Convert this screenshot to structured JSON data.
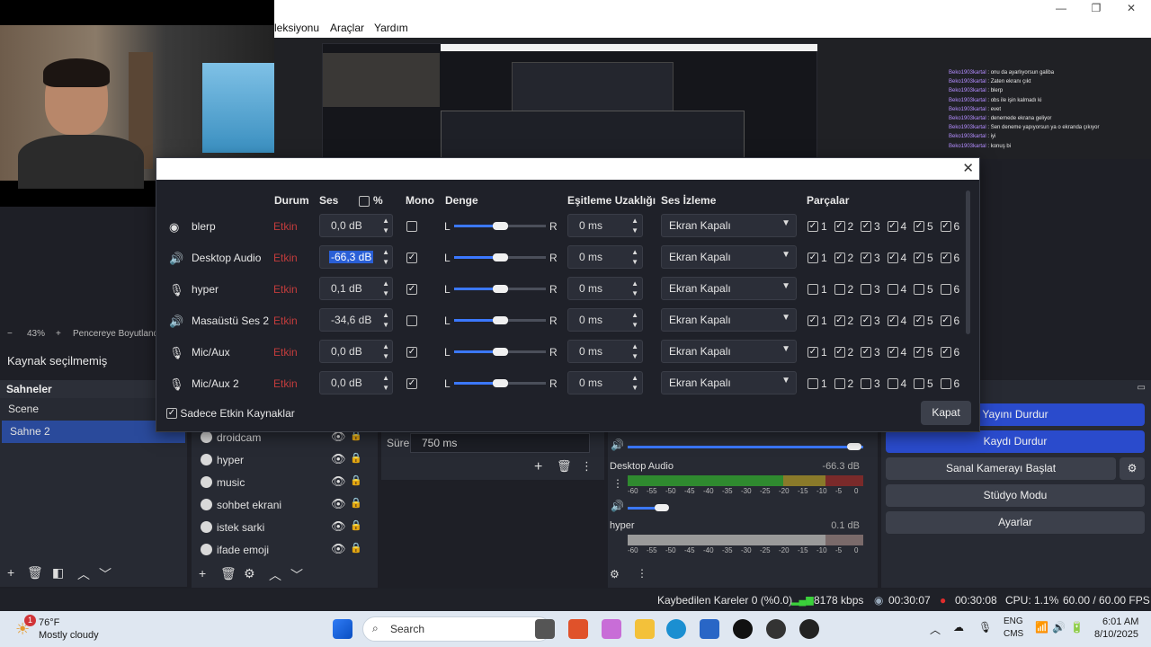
{
  "menu": {
    "items": [
      "leksiyonu",
      "Araçlar",
      "Yardım"
    ]
  },
  "chat": [
    {
      "user": "Beko1903kartal",
      "msg": "onu da ayarlıyorsun galiba"
    },
    {
      "user": "Beko1903kartal",
      "msg": "Zaten ekranı çıkt"
    },
    {
      "user": "Beko1903kartal",
      "msg": "blerp"
    },
    {
      "user": "Beko1903kartal",
      "msg": "obs ile işin kalmadı ki"
    },
    {
      "user": "Beko1903kartal",
      "msg": "evet"
    },
    {
      "user": "Beko1903kartal",
      "msg": "denemede ekrana geliyor"
    },
    {
      "user": "Beko1903kartal",
      "msg": "Sen deneme yapıyorsun ya o ekranda çıkıyor"
    },
    {
      "user": "Beko1903kartal",
      "msg": "iyi"
    },
    {
      "user": "Beko1903kartal",
      "msg": "konuş bi"
    }
  ],
  "zoom": {
    "minus": "−",
    "value": "43%",
    "plus": "+",
    "fit_label": "Pencereye Boyutland"
  },
  "source_status": "Kaynak seçilmemiş",
  "scenes": {
    "title": "Sahneler",
    "items": [
      {
        "label": "Scene",
        "active": false
      },
      {
        "label": "Sahne 2",
        "active": true
      }
    ]
  },
  "sources": {
    "items": [
      "droidcam",
      "hyper",
      "music",
      "sohbet ekrani",
      "istek sarki",
      "ifade emoji"
    ]
  },
  "transitions": {
    "label": "Süre",
    "duration": "750 ms"
  },
  "mixer": {
    "channels": [
      {
        "name": "Desktop Audio",
        "value": "-66.3 dB"
      },
      {
        "name": "hyper",
        "value": "0.1 dB"
      }
    ],
    "scale": [
      "-60",
      "-55",
      "-50",
      "-45",
      "-40",
      "-35",
      "-30",
      "-25",
      "-20",
      "-15",
      "-10",
      "-5",
      "0"
    ]
  },
  "controls": {
    "buttons": [
      {
        "label": "Yayını Durdur",
        "active": true
      },
      {
        "label": "Kaydı Durdur",
        "active": true
      },
      {
        "label": "Sanal Kamerayı Başlat",
        "active": false
      },
      {
        "label": "Stüdyo Modu",
        "active": false
      },
      {
        "label": "Ayarlar",
        "active": false
      }
    ]
  },
  "statusbar": {
    "dropped": "Kaybedilen Kareler 0 (%0.0)",
    "kbps": "8178 kbps",
    "stream_time": "00:30:07",
    "rec_time": "00:30:08",
    "cpu": "CPU: 1.1%",
    "fps": "60.00 / 60.00 FPS"
  },
  "taskbar": {
    "temp": "76°F",
    "weather": "Mostly cloudy",
    "badge": "1",
    "search": "Search",
    "lang1": "ENG",
    "lang2": "CMS",
    "time": "6:01 AM",
    "date": "8/10/2025"
  },
  "dialog": {
    "headers": {
      "status": "Durum",
      "volume": "Ses",
      "percent": "%",
      "mono": "Mono",
      "balance": "Denge",
      "sync": "Eşitleme Uzaklığı",
      "monitoring": "Ses İzleme",
      "tracks": "Parçalar"
    },
    "balance_left": "L",
    "balance_right": "R",
    "rows": [
      {
        "icon": "globe",
        "name": "blerp",
        "status": "Etkin",
        "volume": "0,0 dB",
        "selected": false,
        "mono": false,
        "balance": 0.5,
        "sync": "0 ms",
        "monitor": "Ekran Kapalı",
        "tracks": [
          true,
          true,
          true,
          true,
          true,
          true
        ]
      },
      {
        "icon": "speaker",
        "name": "Desktop Audio",
        "status": "Etkin",
        "volume": "-66,3 dB",
        "selected": true,
        "mono": true,
        "balance": 0.5,
        "sync": "0 ms",
        "monitor": "Ekran Kapalı",
        "tracks": [
          true,
          true,
          true,
          true,
          true,
          true
        ]
      },
      {
        "icon": "mic",
        "name": "hyper",
        "status": "Etkin",
        "volume": "0,1 dB",
        "selected": false,
        "mono": true,
        "balance": 0.5,
        "sync": "0 ms",
        "monitor": "Ekran Kapalı",
        "tracks": [
          false,
          false,
          false,
          false,
          false,
          false
        ]
      },
      {
        "icon": "speaker",
        "name": "Masaüstü Ses 2",
        "status": "Etkin",
        "volume": "-34,6 dB",
        "selected": false,
        "mono": false,
        "balance": 0.5,
        "sync": "0 ms",
        "monitor": "Ekran Kapalı",
        "tracks": [
          true,
          true,
          true,
          true,
          true,
          true
        ]
      },
      {
        "icon": "mic",
        "name": "Mic/Aux",
        "status": "Etkin",
        "volume": "0,0 dB",
        "selected": false,
        "mono": true,
        "balance": 0.5,
        "sync": "0 ms",
        "monitor": "Ekran Kapalı",
        "tracks": [
          true,
          true,
          true,
          true,
          true,
          true
        ]
      },
      {
        "icon": "mic",
        "name": "Mic/Aux 2",
        "status": "Etkin",
        "volume": "0,0 dB",
        "selected": false,
        "mono": true,
        "balance": 0.5,
        "sync": "0 ms",
        "monitor": "Ekran Kapalı",
        "tracks": [
          false,
          false,
          false,
          false,
          false,
          false
        ]
      }
    ],
    "active_only_label": "Sadece Etkin Kaynaklar",
    "active_only": true,
    "close_label": "Kapat"
  }
}
